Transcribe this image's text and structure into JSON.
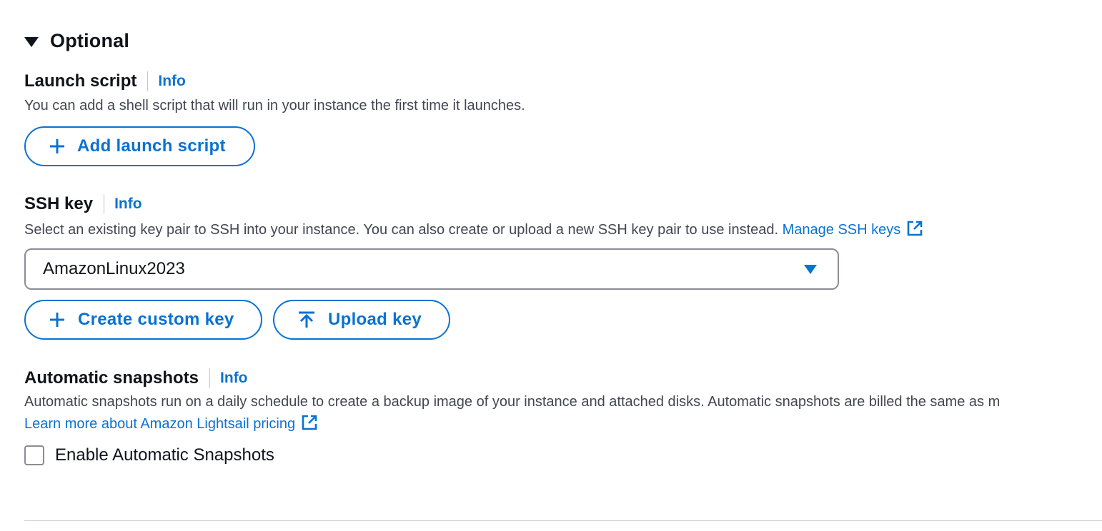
{
  "optional_section": {
    "title": "Optional",
    "expanded": true
  },
  "launch_script": {
    "label": "Launch script",
    "info": "Info",
    "description": "You can add a shell script that will run in your instance the first time it launches.",
    "add_button": "Add launch script"
  },
  "ssh_key": {
    "label": "SSH key",
    "info": "Info",
    "description": "Select an existing key pair to SSH into your instance. You can also create or upload a new SSH key pair to use instead.",
    "manage_link": "Manage SSH keys",
    "selected_key": "AmazonLinux2023",
    "create_button": "Create custom key",
    "upload_button": "Upload key"
  },
  "automatic_snapshots": {
    "label": "Automatic snapshots",
    "info": "Info",
    "description": "Automatic snapshots run on a daily schedule to create a backup image of your instance and attached disks. Automatic snapshots are billed the same as m",
    "pricing_link": "Learn more about Amazon Lightsail pricing",
    "checkbox_label": "Enable Automatic Snapshots",
    "checked": false
  },
  "colors": {
    "accent": "#0972d3",
    "text": "#0f141a",
    "secondary_text": "#424650",
    "border": "#8c8c94"
  },
  "icons": {
    "toggle": "caret-down-icon",
    "add": "plus-icon",
    "upload": "upload-icon",
    "external": "external-link-icon",
    "dropdown": "dropdown-caret-icon"
  }
}
